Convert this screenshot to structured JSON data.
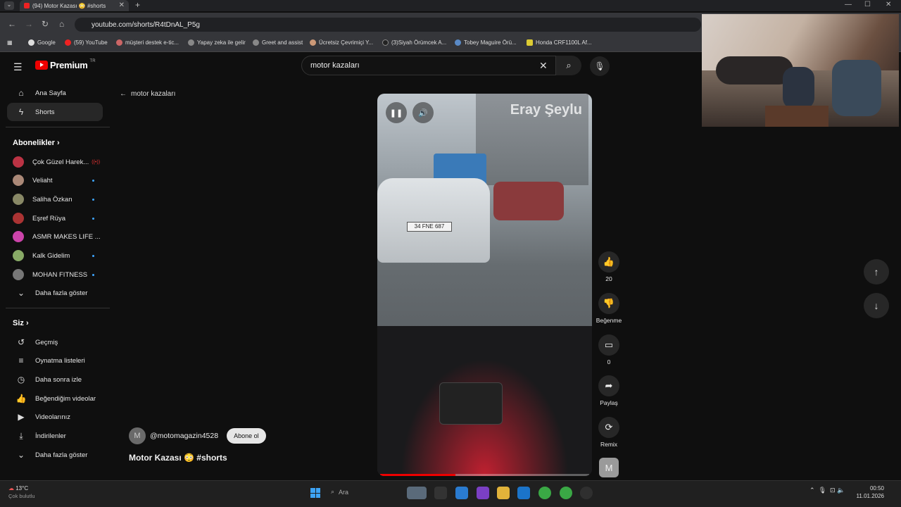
{
  "browser": {
    "tab_title": "(94) Motor Kazası 😳 #shorts",
    "url": "youtube.com/shorts/R4tDnAL_P5g",
    "bookmarks": [
      "Google",
      "(59) YouTube",
      "müşteri destek e-tic...",
      "Yapay zeka ile gelir",
      "Greet and assist",
      "Ücretsiz Çevrimiçi Y...",
      "(3)Siyah Örümcek A...",
      "Tobey Maguire Örü...",
      "Honda CRF1100L Af..."
    ]
  },
  "youtube": {
    "logo_text": "Premium",
    "logo_sup": "TR",
    "search_value": "motor kazaları",
    "back_label": "motor kazaları"
  },
  "sidebar": {
    "main": [
      {
        "label": "Ana Sayfa",
        "icon": "home-icon"
      },
      {
        "label": "Shorts",
        "icon": "shorts-icon"
      }
    ],
    "subs_title": "Abonelikler",
    "subs": [
      {
        "label": "Çok Güzel Harek...",
        "color": "#b34"
      },
      {
        "label": "Veliaht",
        "color": "#a87"
      },
      {
        "label": "Saliha Özkan",
        "color": "#886"
      },
      {
        "label": "Eşref Rüya",
        "color": "#a33"
      },
      {
        "label": "ASMR MAKES LIFE ...",
        "color": "#c4a"
      },
      {
        "label": "Kalk Gidelim",
        "color": "#8a6"
      },
      {
        "label": "MOHAN FITNESS",
        "color": "#777"
      }
    ],
    "subs_more": "Daha fazla göster",
    "you_title": "Siz",
    "you": [
      {
        "label": "Geçmiş"
      },
      {
        "label": "Oynatma listeleri"
      },
      {
        "label": "Daha sonra izle"
      },
      {
        "label": "Beğendiğim videolar"
      },
      {
        "label": "Videolarınız"
      },
      {
        "label": "İndirilenler"
      },
      {
        "label": "Daha fazla göster"
      }
    ]
  },
  "video": {
    "watermark": "Eray Şeylu",
    "plate": "34 FNE 687",
    "progress_fraction": 0.36,
    "channel_initial": "M",
    "channel": "@motomagazin4528",
    "subscribe": "Abone ol",
    "title": "Motor Kazası 😳 #shorts"
  },
  "actions": {
    "likes": "20",
    "dislike": "Beğenme",
    "comments": "0",
    "share": "Paylaş",
    "remix": "Remix",
    "avatar": "M"
  },
  "taskbar": {
    "temp": "13°C",
    "weather": "Çok bulutlu",
    "search": "Ara",
    "time": "00:50",
    "date": "11.01.2026"
  }
}
